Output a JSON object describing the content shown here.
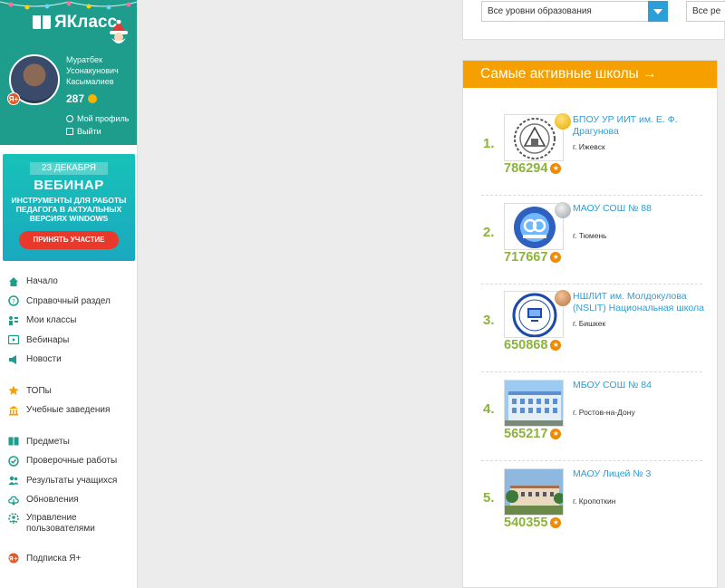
{
  "header": {
    "logo_text": "ЯКласс"
  },
  "user": {
    "name_line1": "Муратбек",
    "name_line2": "Усонакунович",
    "name_line3": "Касымалиев",
    "points": "287",
    "badge": "Я+",
    "profile_link": "Мой профиль",
    "logout_link": "Выйти"
  },
  "banner": {
    "date": "23 ДЕКАБРЯ",
    "title": "ВЕБИНАР",
    "description": "ИНСТРУМЕНТЫ ДЛЯ РАБОТЫ ПЕДАГОГА В АКТУАЛЬНЫХ ВЕРСИЯХ WINDOWS",
    "button": "ПРИНЯТЬ УЧАСТИЕ"
  },
  "nav": {
    "home": "Начало",
    "help": "Справочный раздел",
    "classes": "Мои классы",
    "webinars": "Вебинары",
    "news": "Новости",
    "tops": "ТОПы",
    "institutions": "Учебные заведения",
    "subjects": "Предметы",
    "tests": "Проверочные работы",
    "results": "Результаты учащихся",
    "updates": "Обновления",
    "users_line1": "Управление",
    "users_line2": "пользователями",
    "subscription": "Подписка Я+"
  },
  "filters": {
    "level": "Все уровни образования",
    "second": "Все ре"
  },
  "panel": {
    "title": "Самые активные школы →",
    "schools": [
      {
        "rank": "1.",
        "name_line1": "БПОУ УР ИИТ им. Е. Ф.",
        "name_line2": "Драгунова",
        "city": "г. Ижевск",
        "score": "786294",
        "medal": "gold"
      },
      {
        "rank": "2.",
        "name_line1": "МАОУ СОШ № 88",
        "name_line2": "",
        "city": "г. Тюмень",
        "score": "717667",
        "medal": "silver"
      },
      {
        "rank": "3.",
        "name_line1": "НШЛИТ им. Молдокулова",
        "name_line2": "(NSLIT) Национальная школа",
        "city": "г. Бишкек",
        "score": "650868",
        "medal": "bronze"
      },
      {
        "rank": "4.",
        "name_line1": "МБОУ СОШ № 84",
        "name_line2": "",
        "city": "г. Ростов-на-Дону",
        "score": "565217",
        "medal": ""
      },
      {
        "rank": "5.",
        "name_line1": "МАОУ Лицей № 3",
        "name_line2": "",
        "city": "г. Кропоткин",
        "score": "540355",
        "medal": ""
      }
    ]
  },
  "colors": {
    "brand_green": "#1e9d8c",
    "accent_orange": "#f5a000",
    "link_blue": "#2a9fd8",
    "score_green": "#8cb33a"
  }
}
